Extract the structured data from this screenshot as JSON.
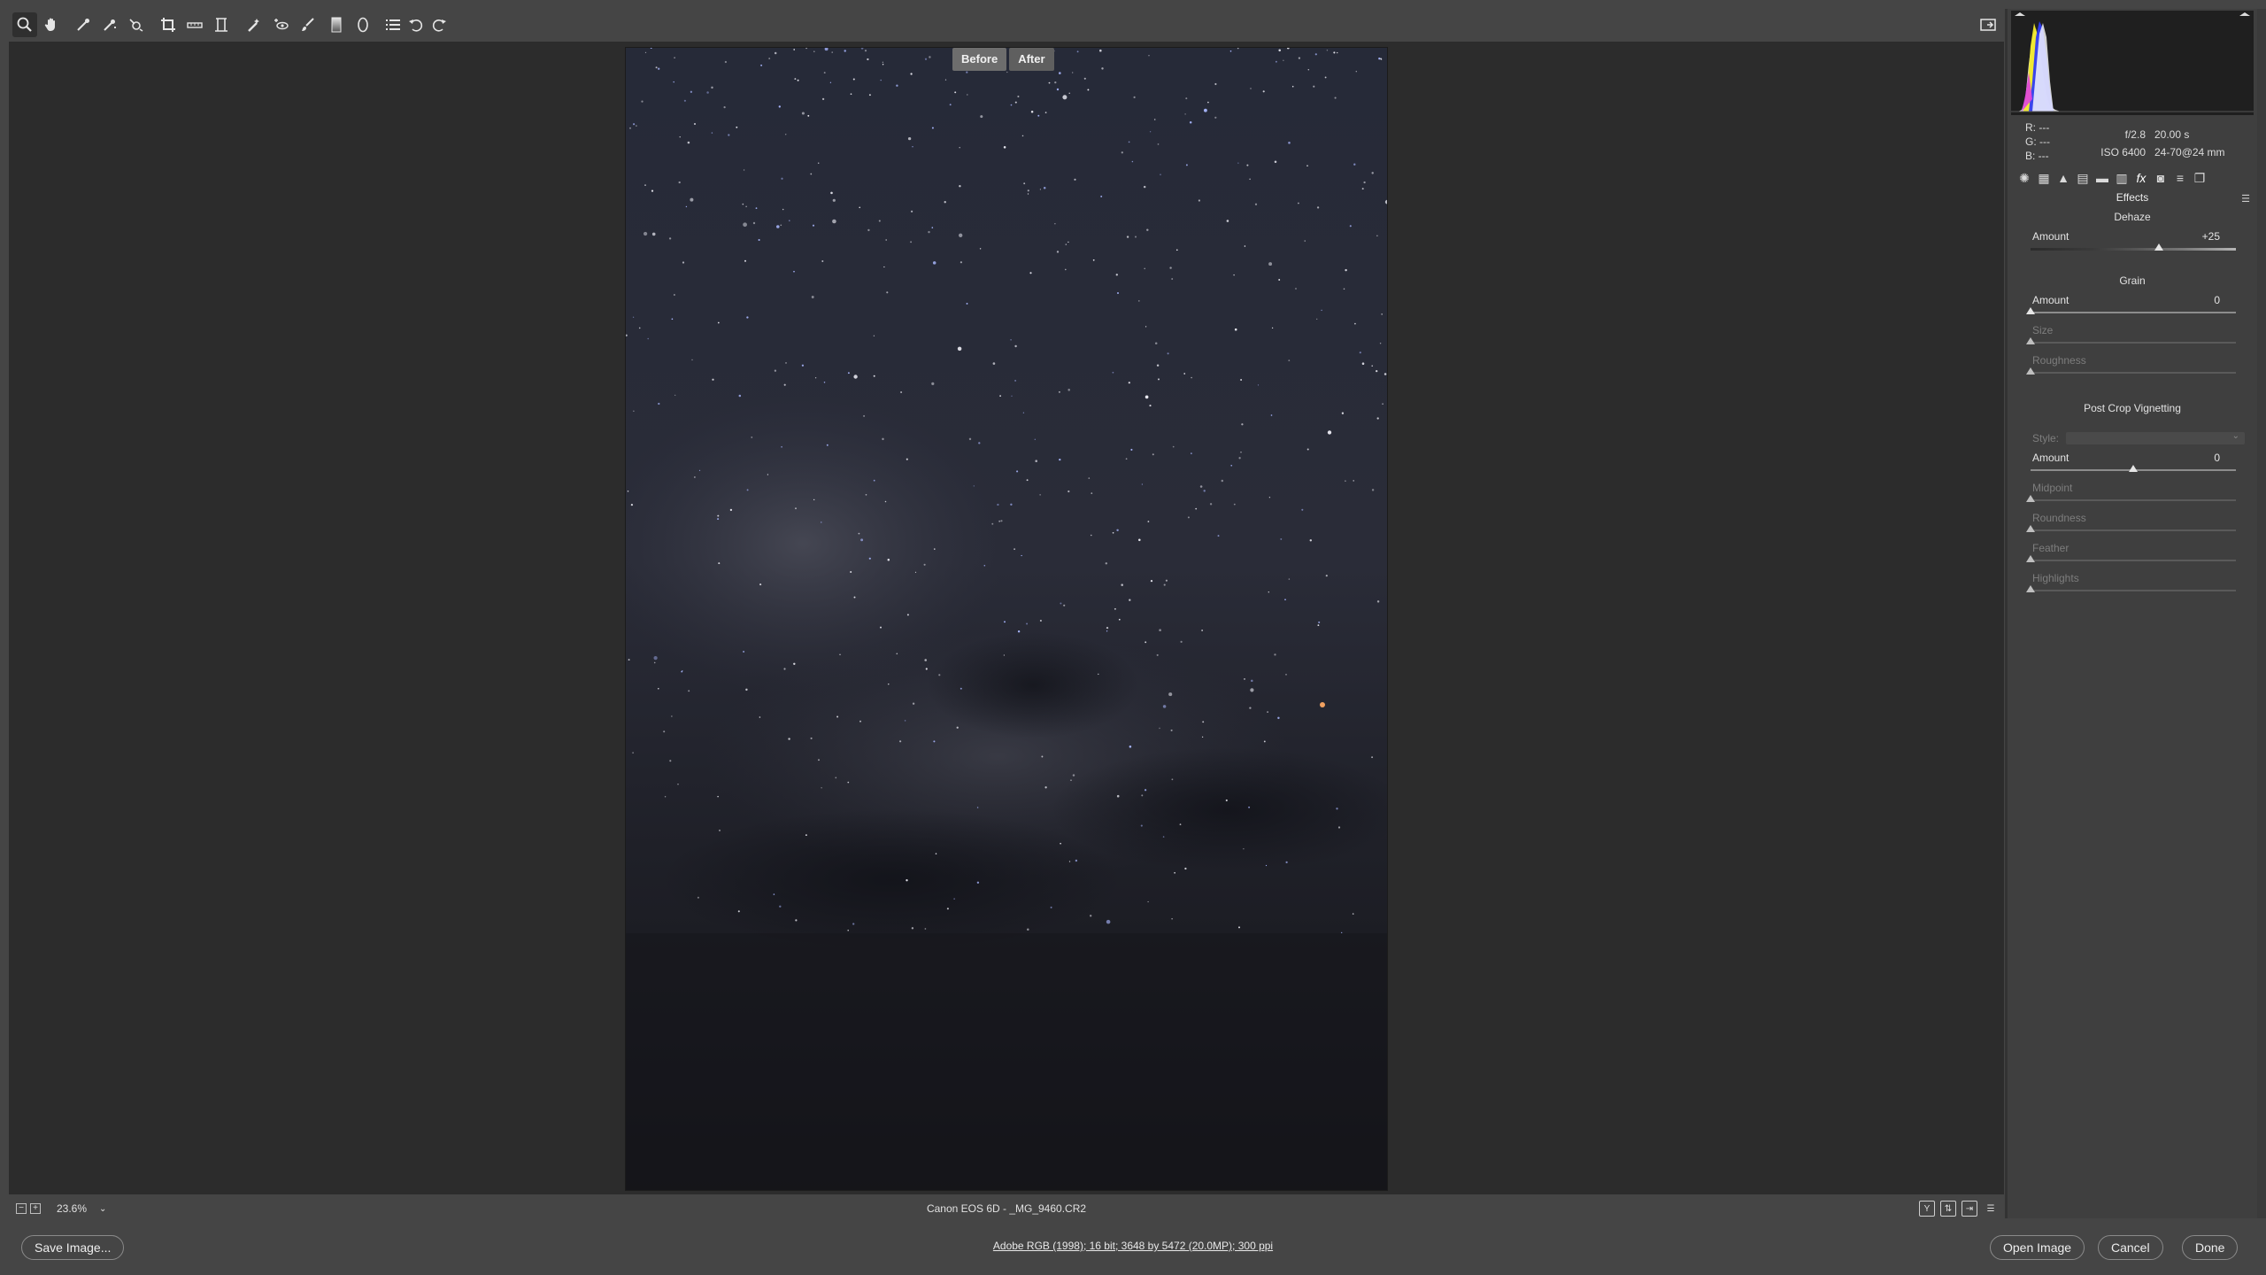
{
  "toolbar": {
    "tools": [
      {
        "name": "zoom-tool-icon",
        "active": true
      },
      {
        "name": "hand-tool-icon"
      },
      {
        "name": "white-balance-tool-icon"
      },
      {
        "name": "color-sampler-tool-icon"
      },
      {
        "name": "targeted-adjustment-tool-icon"
      },
      {
        "name": "crop-tool-icon"
      },
      {
        "name": "straighten-tool-icon"
      },
      {
        "name": "transform-tool-icon"
      },
      {
        "name": "spot-removal-tool-icon"
      },
      {
        "name": "red-eye-removal-icon"
      },
      {
        "name": "adjustment-brush-icon"
      },
      {
        "name": "graduated-filter-icon"
      },
      {
        "name": "radial-filter-icon"
      },
      {
        "name": "preferences-list-icon"
      },
      {
        "name": "rotate-counterclockwise-icon"
      },
      {
        "name": "rotate-clockwise-icon"
      }
    ],
    "fullscreen_icon": "fullscreen-toggle-icon"
  },
  "preview": {
    "before_label": "Before",
    "after_label": "After"
  },
  "status": {
    "zoom": "23.6%",
    "file_title": "Canon EOS 6D  -  _MG_9460.CR2"
  },
  "bottom": {
    "save_label": "Save Image...",
    "workflow": "Adobe RGB (1998); 16 bit; 3648 by 5472 (20.0MP); 300 ppi",
    "open_label": "Open Image",
    "cancel_label": "Cancel",
    "done_label": "Done"
  },
  "readout": {
    "r": "R:   ---",
    "g": "G:   ---",
    "b": "B:   ---",
    "aperture": "f/2.8",
    "shutter": "20.00 s",
    "iso": "ISO 6400",
    "lens": "24-70@24 mm"
  },
  "panel": {
    "section_title": "Effects",
    "dehaze": {
      "title": "Dehaze",
      "amount_label": "Amount",
      "amount_value": "+25",
      "amount_fraction": 0.625
    },
    "grain": {
      "title": "Grain",
      "amount_label": "Amount",
      "amount_value": "0",
      "amount_fraction": 0,
      "size_label": "Size",
      "roughness_label": "Roughness"
    },
    "vignette": {
      "title": "Post Crop Vignetting",
      "style_label": "Style:",
      "amount_label": "Amount",
      "amount_value": "0",
      "amount_fraction": 0.5,
      "midpoint_label": "Midpoint",
      "roundness_label": "Roundness",
      "feather_label": "Feather",
      "highlights_label": "Highlights"
    }
  },
  "colors": {
    "app_bg": "#454545",
    "canvas_bg": "#2c2c2c",
    "sky_top": "#252734",
    "sky_bottom": "#16161c"
  }
}
